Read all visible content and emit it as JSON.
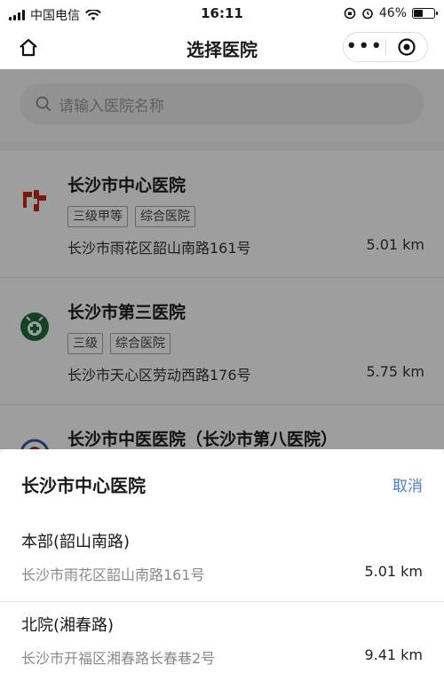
{
  "status_bar": {
    "carrier": "中国电信",
    "time": "16:11",
    "battery": "46%",
    "battery_level": 0.46
  },
  "nav": {
    "title": "选择医院",
    "home_icon": "home-icon",
    "more_icon": "more-dots-icon",
    "close_icon": "target-close-icon"
  },
  "search": {
    "placeholder": "请输入医院名称",
    "icon": "search-icon"
  },
  "hospitals": [
    {
      "name": "长沙市中心医院",
      "tags": [
        "三级甲等",
        "综合医院"
      ],
      "address": "长沙市雨花区韶山南路161号",
      "distance": "5.01 km",
      "logo": "red-cross-logo-icon"
    },
    {
      "name": "长沙市第三医院",
      "tags": [
        "三级",
        "综合医院"
      ],
      "address": "长沙市天心区劳动西路176号",
      "distance": "5.75 km",
      "logo": "green-hospital-logo-icon"
    },
    {
      "name": "长沙市中医医院（长沙市第八医院）",
      "logo": "blue-round-logo-icon"
    }
  ],
  "sheet": {
    "title": "长沙市中心医院",
    "cancel": "取消",
    "branches": [
      {
        "name": "本部(韶山南路)",
        "address": "长沙市雨花区韶山南路161号",
        "distance": "5.01 km"
      },
      {
        "name": "北院(湘春路)",
        "address": "长沙市开福区湘春路长春巷2号",
        "distance": "9.41 km"
      }
    ]
  },
  "colors": {
    "accent": "#4a80c8",
    "overlay": "rgba(0,0,0,0.38)"
  }
}
